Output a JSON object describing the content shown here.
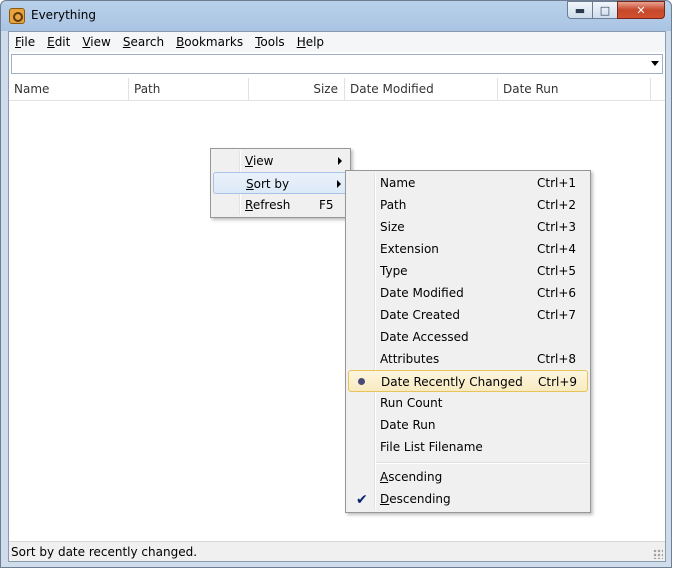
{
  "window": {
    "title": "Everything"
  },
  "menubar": [
    {
      "mnemonic": "F",
      "rest": "ile"
    },
    {
      "mnemonic": "E",
      "rest": "dit"
    },
    {
      "mnemonic": "V",
      "rest": "iew"
    },
    {
      "mnemonic": "S",
      "rest": "earch"
    },
    {
      "mnemonic": "B",
      "rest": "ookmarks"
    },
    {
      "mnemonic": "T",
      "rest": "ools"
    },
    {
      "mnemonic": "H",
      "rest": "elp"
    }
  ],
  "search": {
    "value": ""
  },
  "columns": {
    "name": "Name",
    "path": "Path",
    "size": "Size",
    "date_modified": "Date Modified",
    "date_run": "Date Run"
  },
  "context_menu": {
    "view": {
      "mnemonic": "V",
      "rest": "iew"
    },
    "sort_by": {
      "mnemonic": "S",
      "rest": "ort by"
    },
    "refresh": {
      "mnemonic": "R",
      "rest": "efresh",
      "shortcut": "F5"
    }
  },
  "sort_menu": {
    "items": [
      {
        "label": "Name",
        "shortcut": "Ctrl+1"
      },
      {
        "label": "Path",
        "shortcut": "Ctrl+2"
      },
      {
        "label": "Size",
        "shortcut": "Ctrl+3"
      },
      {
        "label": "Extension",
        "shortcut": "Ctrl+4"
      },
      {
        "label": "Type",
        "shortcut": "Ctrl+5"
      },
      {
        "label": "Date Modified",
        "shortcut": "Ctrl+6"
      },
      {
        "label": "Date Created",
        "shortcut": "Ctrl+7"
      },
      {
        "label": "Date Accessed",
        "shortcut": ""
      },
      {
        "label": "Attributes",
        "shortcut": "Ctrl+8"
      },
      {
        "label": "Date Recently Changed",
        "shortcut": "Ctrl+9",
        "selected": true
      },
      {
        "label": "Run Count",
        "shortcut": ""
      },
      {
        "label": "Date Run",
        "shortcut": ""
      },
      {
        "label": "File List Filename",
        "shortcut": ""
      }
    ],
    "order": [
      {
        "mnemonic": "A",
        "rest": "scending",
        "checked": false
      },
      {
        "mnemonic": "D",
        "rest": "escending",
        "checked": true
      }
    ]
  },
  "status": {
    "text": "Sort by date recently changed."
  },
  "icons": {
    "app": "everything-magnifier-icon",
    "checkmark": "checkmark-icon",
    "radio": "radio-bullet-icon"
  }
}
